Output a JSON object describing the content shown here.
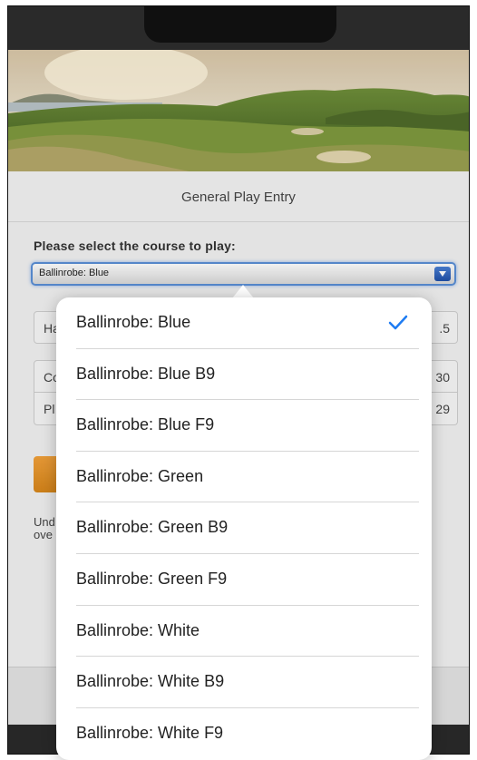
{
  "page": {
    "title": "General Play Entry"
  },
  "form": {
    "course_label": "Please select the course to play:",
    "selected_course": "Ballinrobe: Blue",
    "fields": [
      {
        "key": "Ha",
        "value": ".5"
      },
      {
        "key": "Co",
        "value": "30"
      },
      {
        "key": "Pl",
        "value": "29"
      }
    ],
    "note": "Und Ger ove"
  },
  "dropdown": {
    "options": [
      {
        "label": "Ballinrobe: Blue",
        "selected": true
      },
      {
        "label": "Ballinrobe: Blue B9",
        "selected": false
      },
      {
        "label": "Ballinrobe: Blue F9",
        "selected": false
      },
      {
        "label": "Ballinrobe: Green",
        "selected": false
      },
      {
        "label": "Ballinrobe: Green B9",
        "selected": false
      },
      {
        "label": "Ballinrobe: Green F9",
        "selected": false
      },
      {
        "label": "Ballinrobe: White",
        "selected": false
      },
      {
        "label": "Ballinrobe: White B9",
        "selected": false
      },
      {
        "label": "Ballinrobe: White F9",
        "selected": false
      }
    ]
  },
  "colors": {
    "accent_blue": "#1e7cf2",
    "select_border": "#5a8fd6",
    "orange_button": "#e8941f",
    "dark_bar": "#2d2d2d"
  },
  "icons": {
    "selected_check": "checkmark-icon",
    "select_arrow": "chevron-down-icon"
  }
}
